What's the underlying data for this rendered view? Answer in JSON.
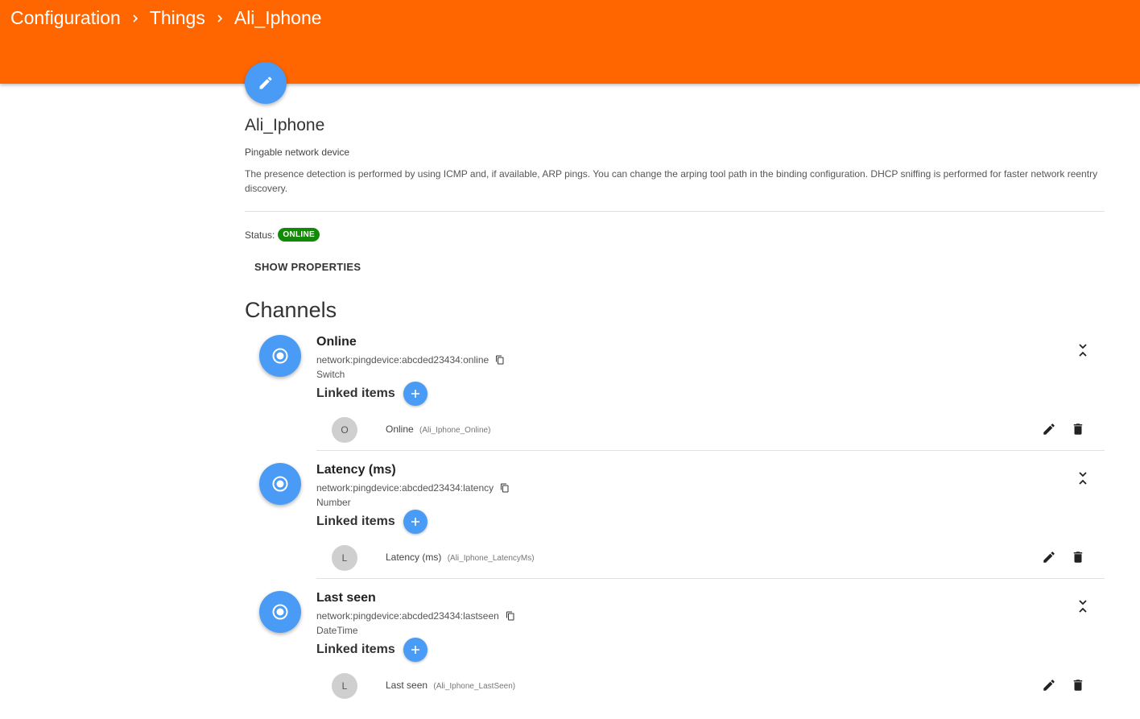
{
  "breadcrumb": [
    "Configuration",
    "Things",
    "Ali_Iphone"
  ],
  "thing": {
    "title": "Ali_Iphone",
    "type": "Pingable network device",
    "description": "The presence detection is performed by using ICMP and, if available, ARP pings. You can change the arping tool path in the binding configuration. DHCP sniffing is performed for faster network reentry discovery.",
    "status_label": "Status:",
    "status_value": "ONLINE",
    "status_color": "#138a07"
  },
  "show_properties_label": "SHOW PROPERTIES",
  "channels_title": "Channels",
  "linked_items_label": "Linked items",
  "channels": [
    {
      "name": "Online",
      "uid": "network:pingdevice:abcded23434:online",
      "type": "Switch",
      "item": {
        "avatar": "O",
        "label": "Online",
        "name": "(Ali_Iphone_Online)"
      }
    },
    {
      "name": "Latency (ms)",
      "uid": "network:pingdevice:abcded23434:latency",
      "type": "Number",
      "item": {
        "avatar": "L",
        "label": "Latency (ms)",
        "name": "(Ali_Iphone_LatencyMs)"
      }
    },
    {
      "name": "Last seen",
      "uid": "network:pingdevice:abcded23434:lastseen",
      "type": "DateTime",
      "item": {
        "avatar": "L",
        "label": "Last seen",
        "name": "(Ali_Iphone_LastSeen)"
      }
    }
  ],
  "colors": {
    "header": "#ff6600",
    "accent": "#4a9bf5",
    "online_badge": "#138a07"
  },
  "icons": {
    "edit": "pencil-icon",
    "channel": "radio-button-icon",
    "copy": "copy-icon",
    "collapse": "unfold-less-icon",
    "add": "plus-icon",
    "delete": "trash-icon",
    "chevron": "chevron-right-icon"
  }
}
